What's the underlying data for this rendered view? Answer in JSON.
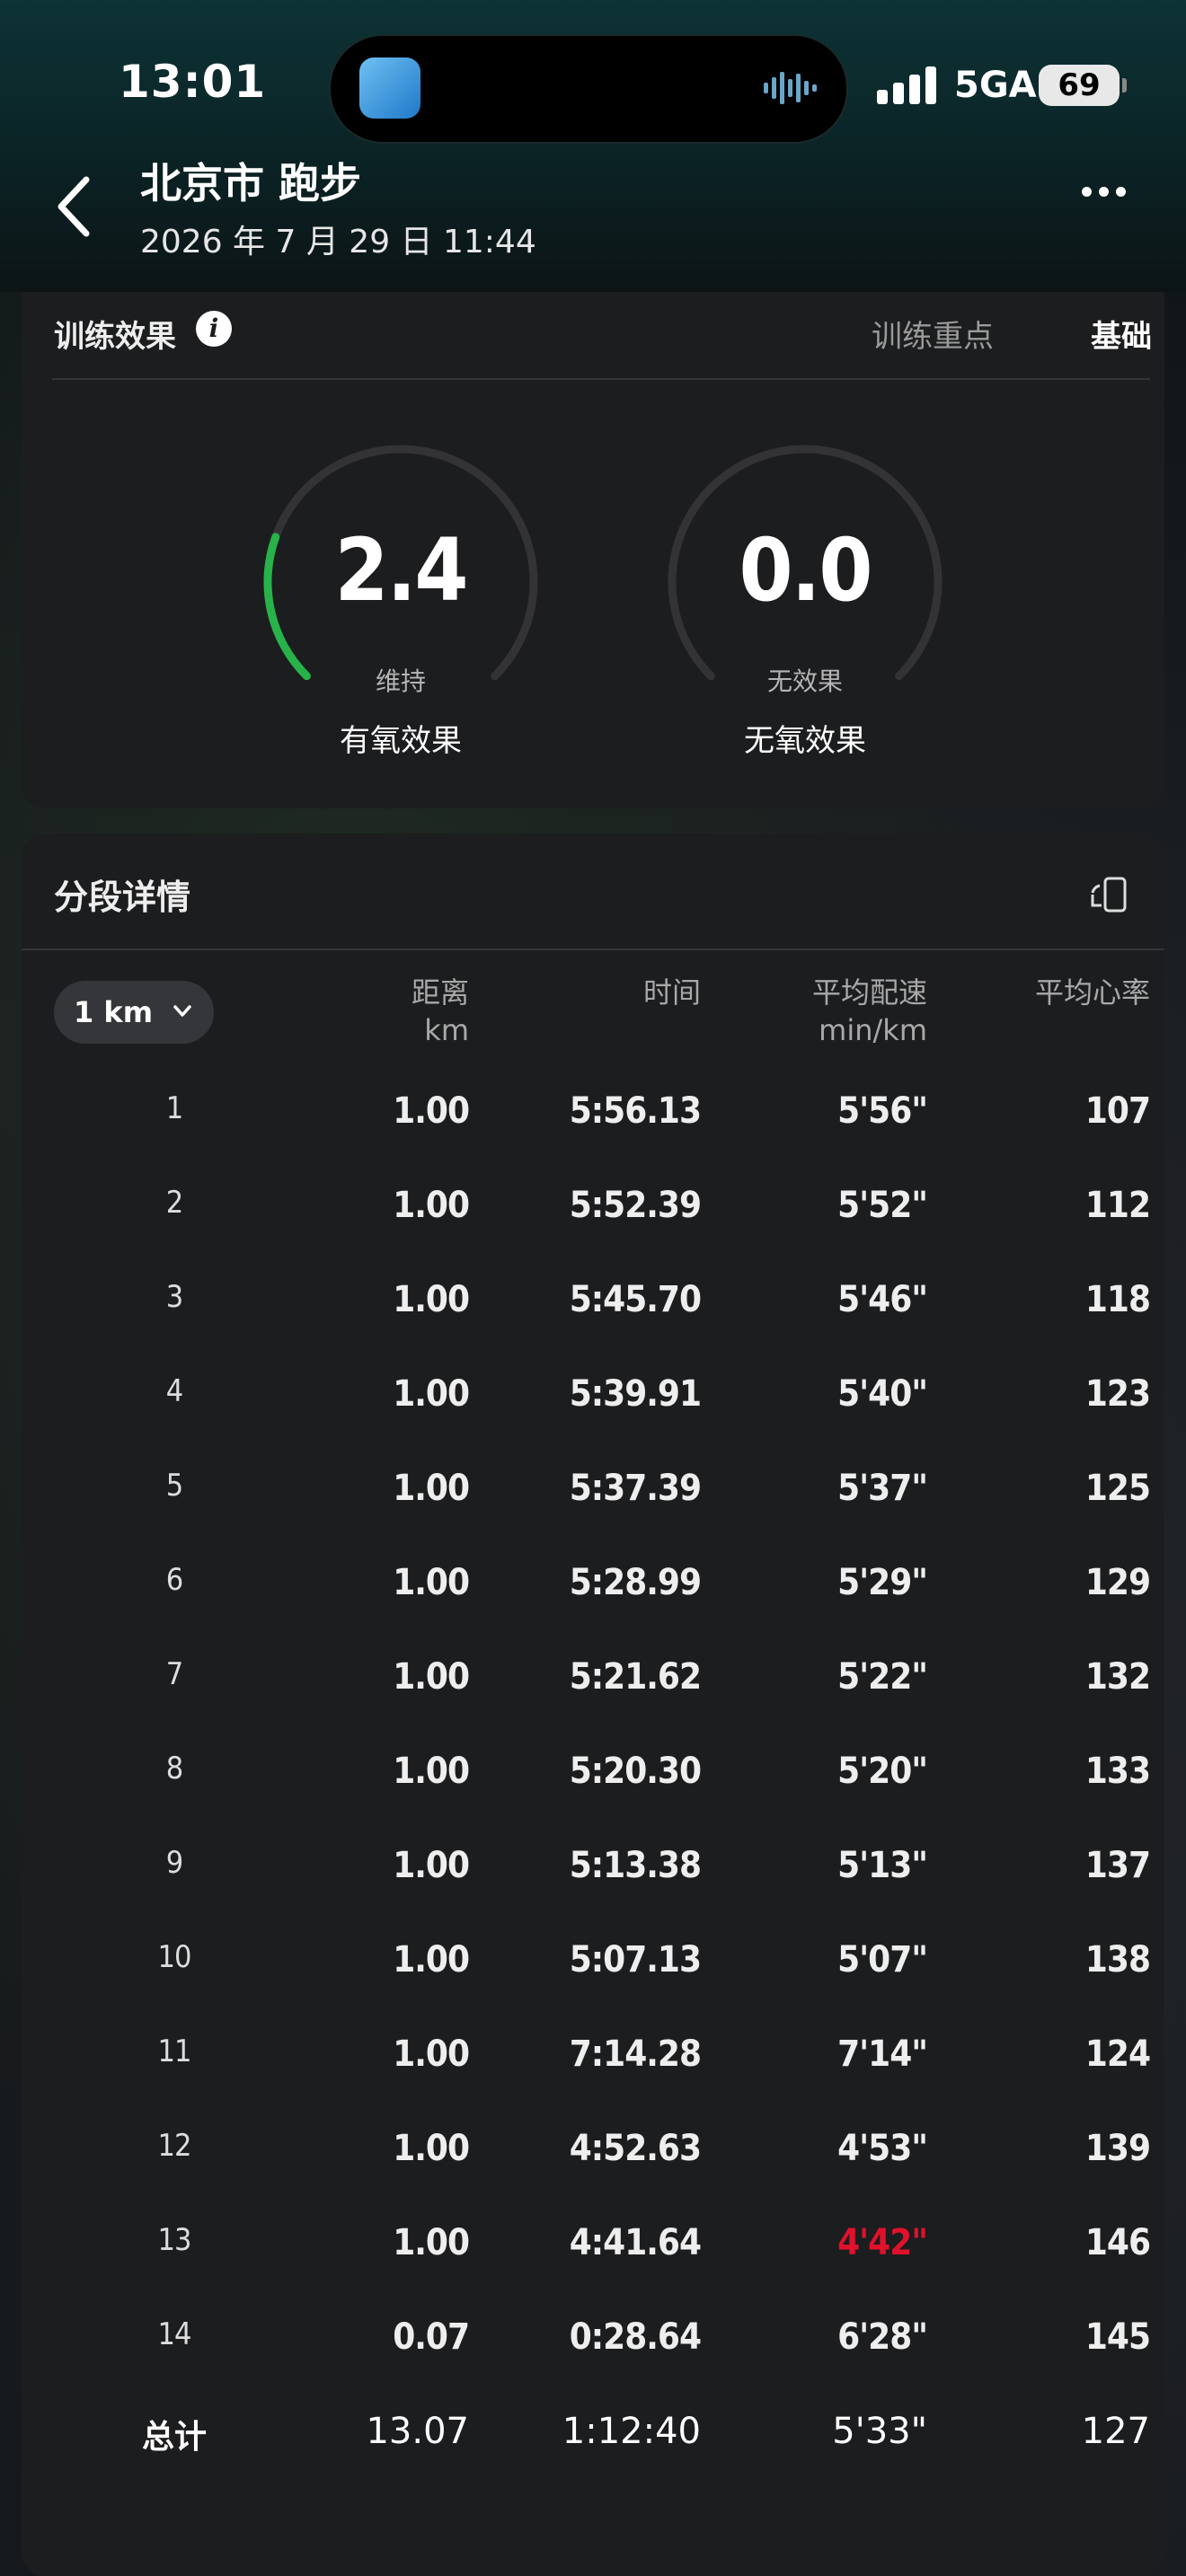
{
  "status_bar": {
    "time": "13:01",
    "network": "5GA",
    "battery": "69"
  },
  "header": {
    "title": "北京市 跑步",
    "subtitle": "2026 年 7 月 29 日 11:44"
  },
  "training_effect": {
    "label": "训练效果",
    "focus_label": "训练重点",
    "focus_value": "基础",
    "aerobic": {
      "value": "2.4",
      "level": "维持",
      "name": "有氧效果",
      "fill": 0.24,
      "color": "#27b34a"
    },
    "anaerobic": {
      "value": "0.0",
      "level": "无效果",
      "name": "无氧效果",
      "fill": 0.0,
      "color": "#27b34a"
    }
  },
  "splits": {
    "title": "分段详情",
    "unit_selector": "1 km",
    "headers": {
      "distance": "距离",
      "distance_unit": "km",
      "time": "时间",
      "pace": "平均配速",
      "pace_unit": "min/km",
      "heart_rate": "平均心率"
    },
    "highlight_color": "#e0112b",
    "rows": [
      {
        "idx": "1",
        "dist": "1.00",
        "time": "5:56.13",
        "pace": "5'56\"",
        "hr": "107"
      },
      {
        "idx": "2",
        "dist": "1.00",
        "time": "5:52.39",
        "pace": "5'52\"",
        "hr": "112"
      },
      {
        "idx": "3",
        "dist": "1.00",
        "time": "5:45.70",
        "pace": "5'46\"",
        "hr": "118"
      },
      {
        "idx": "4",
        "dist": "1.00",
        "time": "5:39.91",
        "pace": "5'40\"",
        "hr": "123"
      },
      {
        "idx": "5",
        "dist": "1.00",
        "time": "5:37.39",
        "pace": "5'37\"",
        "hr": "125"
      },
      {
        "idx": "6",
        "dist": "1.00",
        "time": "5:28.99",
        "pace": "5'29\"",
        "hr": "129"
      },
      {
        "idx": "7",
        "dist": "1.00",
        "time": "5:21.62",
        "pace": "5'22\"",
        "hr": "132"
      },
      {
        "idx": "8",
        "dist": "1.00",
        "time": "5:20.30",
        "pace": "5'20\"",
        "hr": "133"
      },
      {
        "idx": "9",
        "dist": "1.00",
        "time": "5:13.38",
        "pace": "5'13\"",
        "hr": "137"
      },
      {
        "idx": "10",
        "dist": "1.00",
        "time": "5:07.13",
        "pace": "5'07\"",
        "hr": "138"
      },
      {
        "idx": "11",
        "dist": "1.00",
        "time": "7:14.28",
        "pace": "7'14\"",
        "hr": "124"
      },
      {
        "idx": "12",
        "dist": "1.00",
        "time": "4:52.63",
        "pace": "4'53\"",
        "hr": "139"
      },
      {
        "idx": "13",
        "dist": "1.00",
        "time": "4:41.64",
        "pace": "4'42\"",
        "hr": "146",
        "fastest": true
      },
      {
        "idx": "14",
        "dist": "0.07",
        "time": "0:28.64",
        "pace": "6'28\"",
        "hr": "145"
      }
    ],
    "total": {
      "label": "总计",
      "dist": "13.07",
      "time": "1:12:40",
      "pace": "5'33\"",
      "hr": "127"
    }
  }
}
